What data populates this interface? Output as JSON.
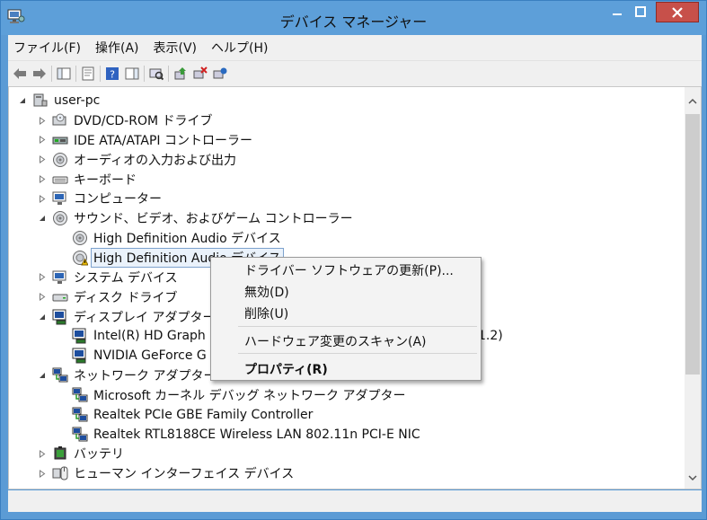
{
  "window": {
    "title": "デバイス マネージャー"
  },
  "menubar": {
    "items": [
      "ファイル(F)",
      "操作(A)",
      "表示(V)",
      "ヘルプ(H)"
    ]
  },
  "tree": {
    "root": "user-pc",
    "rows": [
      {
        "label": "DVD/CD-ROM ドライブ",
        "icon": "dvd-drive-icon",
        "expanded": false
      },
      {
        "label": "IDE ATA/ATAPI コントローラー",
        "icon": "ide-controller-icon",
        "expanded": false
      },
      {
        "label": "オーディオの入力および出力",
        "icon": "speaker-icon",
        "expanded": false
      },
      {
        "label": "キーボード",
        "icon": "keyboard-icon",
        "expanded": false
      },
      {
        "label": "コンピューター",
        "icon": "computer-icon",
        "expanded": false
      },
      {
        "label": "サウンド、ビデオ、およびゲーム コントローラー",
        "icon": "speaker-icon",
        "expanded": true
      },
      {
        "label": "High Definition Audio デバイス",
        "icon": "speaker-icon",
        "child": true
      },
      {
        "label": "High Definition Audio デバイス",
        "icon": "speaker-warning-icon",
        "child": true,
        "selected": true
      },
      {
        "label": "システム デバイス",
        "icon": "computer-icon",
        "expanded": false
      },
      {
        "label": "ディスク ドライブ",
        "icon": "disk-drive-icon",
        "expanded": false
      },
      {
        "label": "ディスプレイ アダプター",
        "icon": "display-adapter-icon",
        "expanded": true
      },
      {
        "label": "Intel(R) HD Graph",
        "suffix": "1.2)",
        "icon": "display-adapter-icon",
        "child": true
      },
      {
        "label": "NVIDIA GeForce G",
        "icon": "display-adapter-icon",
        "child": true
      },
      {
        "label": "ネットワーク アダプター",
        "icon": "network-adapter-icon",
        "expanded": true
      },
      {
        "label": "Microsoft カーネル デバッグ ネットワーク アダプター",
        "icon": "network-adapter-icon",
        "child": true
      },
      {
        "label": "Realtek PCIe GBE Family Controller",
        "icon": "network-adapter-icon",
        "child": true
      },
      {
        "label": "Realtek RTL8188CE Wireless LAN 802.11n PCI-E NIC",
        "icon": "network-adapter-icon",
        "child": true
      },
      {
        "label": "バッテリ",
        "icon": "battery-icon",
        "expanded": false
      },
      {
        "label": "ヒューマン インターフェイス デバイス",
        "icon": "hid-icon",
        "expanded": false
      }
    ]
  },
  "context_menu": {
    "update_driver": "ドライバー ソフトウェアの更新(P)...",
    "disable": "無効(D)",
    "uninstall": "削除(U)",
    "scan_hardware": "ハードウェア変更のスキャン(A)",
    "properties": "プロパティ(R)"
  },
  "colors": {
    "titlebar": "#5d9fd9",
    "close": "#c7504a",
    "selection": "#eaf2fb"
  }
}
